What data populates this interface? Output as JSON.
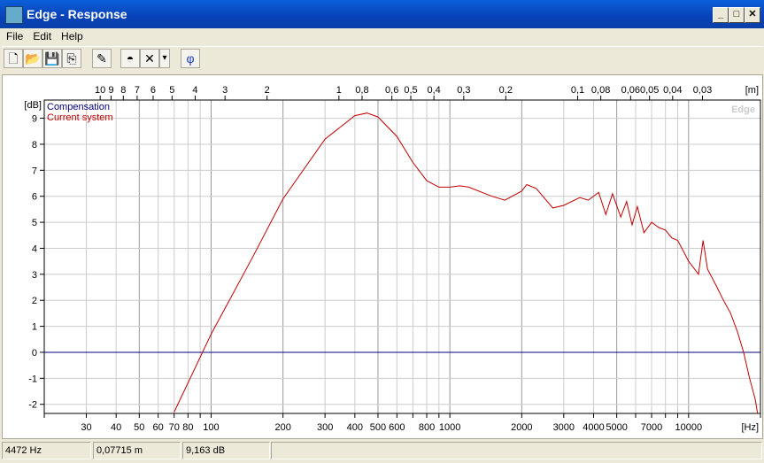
{
  "window": {
    "title": "Edge - Response",
    "min": "_",
    "max": "□",
    "close": "✕"
  },
  "menu": [
    "File",
    "Edit",
    "Help"
  ],
  "toolbar": [
    {
      "icon": "new-file-icon",
      "glyph": "🗋"
    },
    {
      "icon": "open-folder-icon",
      "glyph": "📂"
    },
    {
      "icon": "save-icon",
      "glyph": "💾"
    },
    {
      "icon": "copy-icon",
      "glyph": "⎘"
    },
    {
      "icon": "pencil-icon",
      "glyph": "✎"
    },
    {
      "icon": "dome-icon",
      "glyph": "◓"
    },
    {
      "icon": "delete-icon",
      "glyph": "✕"
    },
    {
      "icon": "dropdown-arrow-icon",
      "glyph": "▾"
    },
    {
      "icon": "phase-icon",
      "glyph": "φ"
    }
  ],
  "status": {
    "freq": "4472 Hz",
    "wavelength": "0,07715 m",
    "level": "9,163 dB"
  },
  "chart_data": {
    "type": "line",
    "watermark": "Edge",
    "xlabel": "[Hz]",
    "ylabel": "[dB]",
    "top_axis_label": "[m]",
    "xscale": "log",
    "xlim": [
      20,
      20000
    ],
    "ylim": [
      -2.35,
      9.7
    ],
    "yticks": [
      -2,
      -1,
      0,
      1,
      2,
      3,
      4,
      5,
      6,
      7,
      8,
      9
    ],
    "xtick_labels": [
      "30",
      "40",
      "50",
      "60",
      "70",
      "80",
      "100",
      "200",
      "300",
      "400",
      "500",
      "600",
      "800",
      "1000",
      "2000",
      "3000",
      "4000",
      "5000",
      "7000",
      "10000"
    ],
    "top_tick_labels": [
      "10",
      "9",
      "8",
      "7",
      "6",
      "5",
      "4",
      "3",
      "2",
      "1",
      "0,8",
      "0,6",
      "0,5",
      "0,4",
      "0,3",
      "0,2",
      "0,1",
      "0,08",
      "0,06",
      "0,05",
      "0,04",
      "0,03"
    ],
    "legend": [
      {
        "name": "Compensation",
        "color": "#000080"
      },
      {
        "name": "Current system",
        "color": "#c00000"
      }
    ],
    "series": [
      {
        "name": "Compensation",
        "color": "#000080",
        "x": [
          20,
          20000
        ],
        "y": [
          0,
          0
        ]
      },
      {
        "name": "Current system",
        "color": "#c00000",
        "x": [
          70,
          100,
          150,
          200,
          300,
          400,
          450,
          500,
          600,
          700,
          800,
          900,
          1000,
          1100,
          1200,
          1500,
          1700,
          2000,
          2100,
          2300,
          2700,
          3000,
          3500,
          3800,
          4200,
          4500,
          4800,
          5200,
          5500,
          5800,
          6100,
          6500,
          7000,
          7500,
          8000,
          8500,
          9000,
          9500,
          10000,
          11000,
          11500,
          12000,
          13000,
          14000,
          15000,
          16000,
          17000,
          18000,
          19000,
          19500
        ],
        "y": [
          -2.3,
          0.7,
          3.7,
          5.9,
          8.2,
          9.1,
          9.2,
          9.05,
          8.3,
          7.3,
          6.6,
          6.35,
          6.35,
          6.4,
          6.35,
          6.0,
          5.85,
          6.2,
          6.45,
          6.3,
          5.55,
          5.65,
          5.95,
          5.85,
          6.15,
          5.3,
          6.1,
          5.2,
          5.8,
          4.9,
          5.6,
          4.6,
          5.0,
          4.8,
          4.7,
          4.4,
          4.3,
          3.9,
          3.5,
          3.0,
          4.3,
          3.2,
          2.6,
          2.0,
          1.5,
          0.8,
          0.0,
          -1.0,
          -1.8,
          -2.4
        ]
      }
    ]
  }
}
